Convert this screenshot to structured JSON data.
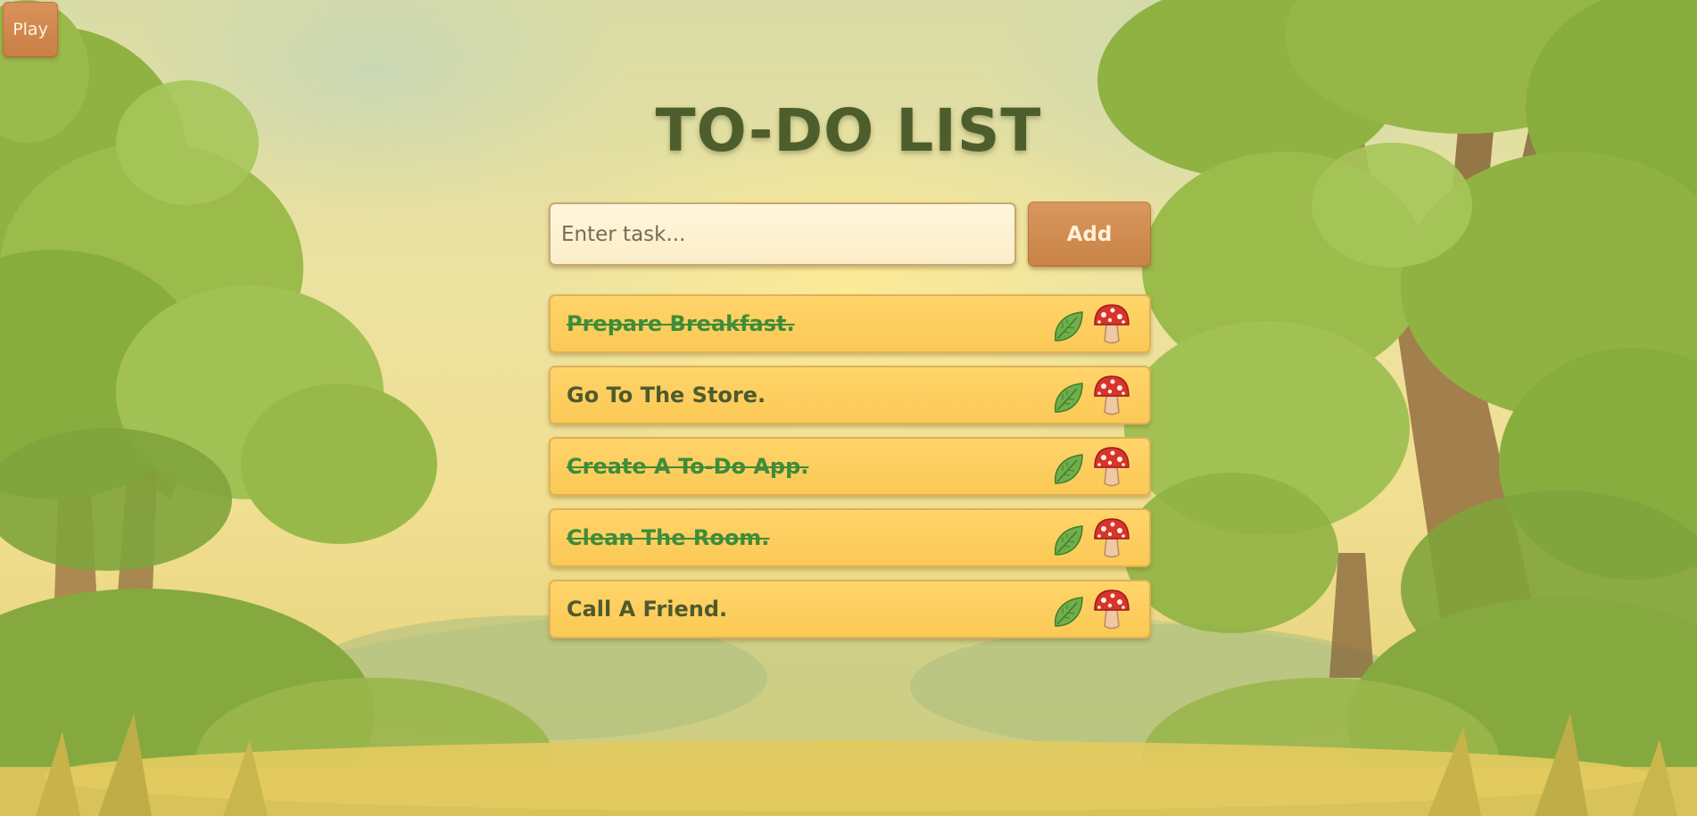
{
  "play_button": {
    "label": "Play"
  },
  "title": "TO-DO LIST",
  "task_input": {
    "placeholder": "Enter task...",
    "value": ""
  },
  "add_button": {
    "label": "Add"
  },
  "tasks": [
    {
      "text": "Prepare Breakfast.",
      "done": true
    },
    {
      "text": "Go To The Store.",
      "done": false
    },
    {
      "text": "Create A To-Do App.",
      "done": true
    },
    {
      "text": "Clean The Room.",
      "done": true
    },
    {
      "text": "Call A Friend.",
      "done": false
    }
  ],
  "task_actions": {
    "complete_icon": "leaf-icon",
    "delete_icon": "mushroom-icon"
  },
  "colors": {
    "title": "#4d5e2c",
    "task_bg": "#ffd46a",
    "task_text": "#4f5a2c",
    "done_text": "#3e8c3a",
    "button": "#c88245"
  }
}
